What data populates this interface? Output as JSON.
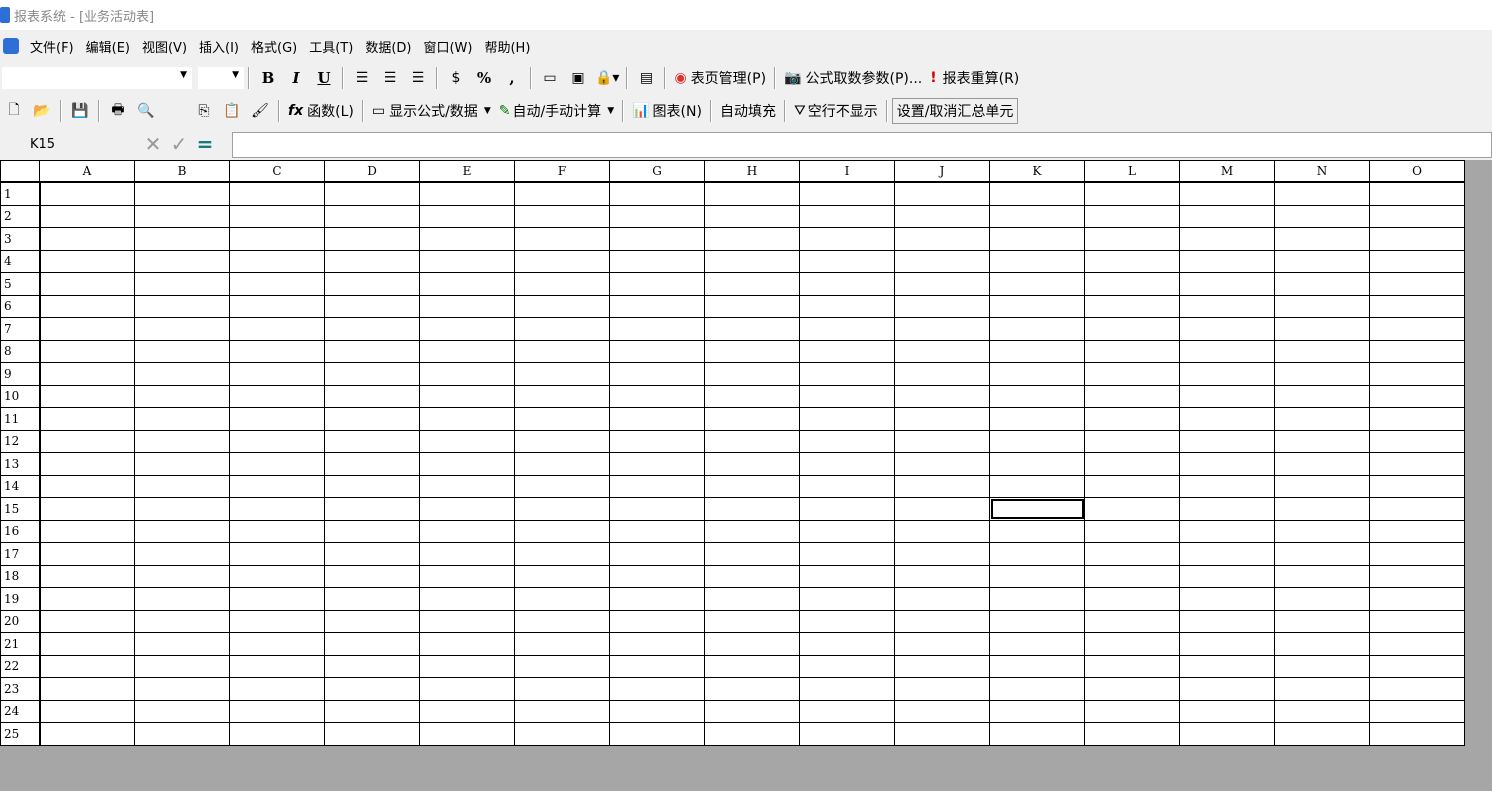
{
  "window": {
    "title": "报表系统 - [业务活动表]"
  },
  "menu": [
    "文件(F)",
    "编辑(E)",
    "视图(V)",
    "插入(I)",
    "格式(G)",
    "工具(T)",
    "数据(D)",
    "窗口(W)",
    "帮助(H)"
  ],
  "toolbar1": {
    "bold": "B",
    "italic": "I",
    "underline": "U",
    "percent": "%",
    "comma": ",",
    "page_manage": "表页管理(P)",
    "formula_params": "公式取数参数(P)...",
    "recalc": "报表重算(R)"
  },
  "toolbar2": {
    "function": "函数(L)",
    "show_formula": "显示公式/数据",
    "auto_manual": "自动/手动计算",
    "chart": "图表(N)",
    "autofill": "自动填充",
    "hide_empty": "空行不显示",
    "summary_unit": "设置/取消汇总单元"
  },
  "formula_bar": {
    "cell_ref": "K15",
    "value": ""
  },
  "sheet": {
    "columns": [
      "A",
      "B",
      "C",
      "D",
      "E",
      "F",
      "G",
      "H",
      "I",
      "J",
      "K",
      "L",
      "M",
      "N",
      "O"
    ],
    "rows": [
      "1",
      "2",
      "3",
      "4",
      "5",
      "6",
      "7",
      "8",
      "9",
      "10",
      "11",
      "12",
      "13",
      "14",
      "15",
      "16",
      "17",
      "18",
      "19",
      "20",
      "21",
      "22",
      "23",
      "24",
      "25"
    ],
    "selected_cell": "K15"
  }
}
